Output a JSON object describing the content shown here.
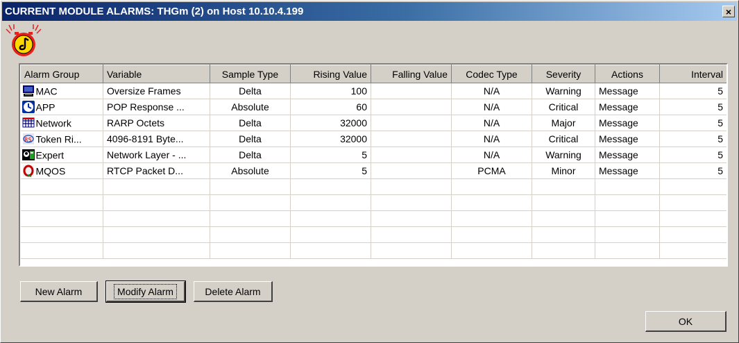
{
  "window": {
    "title": "CURRENT MODULE ALARMS: THGm (2) on Host 10.10.4.199",
    "close_label": "×"
  },
  "table": {
    "columns": [
      "Alarm Group",
      "Variable",
      "Sample Type",
      "Rising Value",
      "Falling Value",
      "Codec Type",
      "Severity",
      "Actions",
      "Interval"
    ],
    "rows": [
      {
        "icon": "computer-icon",
        "group": "MAC",
        "variable": "Oversize Frames",
        "sample_type": "Delta",
        "rising": "100",
        "falling": "",
        "codec": "N/A",
        "severity": "Warning",
        "actions": "Message",
        "interval": "5"
      },
      {
        "icon": "clock-icon",
        "group": "APP",
        "variable": "POP Response ...",
        "sample_type": "Absolute",
        "rising": "60",
        "falling": "",
        "codec": "N/A",
        "severity": "Critical",
        "actions": "Message",
        "interval": "5"
      },
      {
        "icon": "network-grid-icon",
        "group": "Network",
        "variable": "RARP Octets",
        "sample_type": "Delta",
        "rising": "32000",
        "falling": "",
        "codec": "N/A",
        "severity": "Major",
        "actions": "Message",
        "interval": "5"
      },
      {
        "icon": "token-ring-icon",
        "group": "Token Ri...",
        "variable": "4096-8191 Byte...",
        "sample_type": "Delta",
        "rising": "32000",
        "falling": "",
        "codec": "N/A",
        "severity": "Critical",
        "actions": "Message",
        "interval": "5"
      },
      {
        "icon": "expert-icon",
        "group": "Expert",
        "variable": "Network Layer - ...",
        "sample_type": "Delta",
        "rising": "5",
        "falling": "",
        "codec": "N/A",
        "severity": "Warning",
        "actions": "Message",
        "interval": "5"
      },
      {
        "icon": "qos-icon",
        "group": "MQOS",
        "variable": "RTCP Packet D...",
        "sample_type": "Absolute",
        "rising": "5",
        "falling": "",
        "codec": "PCMA",
        "severity": "Minor",
        "actions": "Message",
        "interval": "5"
      }
    ]
  },
  "buttons": {
    "new_alarm": "New Alarm",
    "modify_alarm": "Modify Alarm",
    "delete_alarm": "Delete Alarm",
    "ok": "OK"
  },
  "colors": {
    "title_gradient_start": "#0a246a",
    "title_gradient_end": "#a6caf0",
    "dialog_face": "#d4d0c8"
  }
}
